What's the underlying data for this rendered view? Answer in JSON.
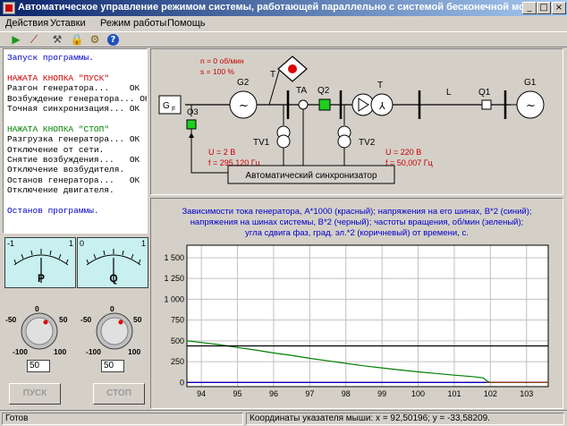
{
  "window": {
    "title": "Автоматическое управление режимом системы, работающей параллельно с системой бесконечной мощности",
    "controls": [
      "_",
      "□",
      "×"
    ]
  },
  "menu": [
    "Действия",
    "Уставки",
    "Режим работы",
    "Помощь"
  ],
  "toolbar": {
    "icons": [
      "play-icon",
      "disconnect-icon",
      "tools-icon",
      "lock-icon",
      "settings-icon",
      "help-icon"
    ]
  },
  "log": {
    "lines": [
      {
        "text": "Запуск программы.",
        "color": "#0000cc"
      },
      {
        "text": "",
        "color": "#000000"
      },
      {
        "text": "НАЖАТА КНОПКА \"ПУСК\"",
        "color": "#cc0000"
      },
      {
        "text": "Разгон генератора...    ОК",
        "color": "#000000"
      },
      {
        "text": "Возбуждение генератора... ОК",
        "color": "#000000"
      },
      {
        "text": "Точная синхронизация... ОК",
        "color": "#000000"
      },
      {
        "text": "",
        "color": "#000000"
      },
      {
        "text": "НАЖАТА КНОПКА \"СТОП\"",
        "color": "#008000"
      },
      {
        "text": "Разгрузка генератора... ОК",
        "color": "#000000"
      },
      {
        "text": "Отключение от сети.",
        "color": "#000000"
      },
      {
        "text": "Снятие возбуждения...   ОК",
        "color": "#000000"
      },
      {
        "text": "Отключение возбудителя.",
        "color": "#000000"
      },
      {
        "text": "Останов генератора...   ОК",
        "color": "#000000"
      },
      {
        "text": "Отключение двигателя.",
        "color": "#000000"
      },
      {
        "text": "",
        "color": "#000000"
      },
      {
        "text": "Останов программы.",
        "color": "#0000cc"
      }
    ]
  },
  "meters": [
    {
      "letter": "P",
      "min": "-1",
      "max": "1",
      "value": 0
    },
    {
      "letter": "Q",
      "min": "0",
      "max": "1",
      "value": 0.5
    }
  ],
  "knobs": [
    {
      "labels": [
        "0",
        "-50",
        "50",
        "-100",
        "100"
      ],
      "input_value": "50"
    },
    {
      "labels": [
        "0",
        "-50",
        "50",
        "-100",
        "100"
      ],
      "input_value": "50"
    }
  ],
  "buttons": {
    "start": "ПУСК",
    "stop": "СТОП"
  },
  "schematic": {
    "speed_text": "n = 0 об/мин",
    "slip_text": "s = 100 %",
    "labels": {
      "G2": "G2",
      "T_top": "T",
      "TA": "TA",
      "Q2": "Q2",
      "T2": "T",
      "L": "L",
      "Q1": "Q1",
      "G1": "G1",
      "GF": "G",
      "GF_sub": "F",
      "Q3": "Q3",
      "TV1": "TV1",
      "TV2": "TV2"
    },
    "gen_voltage": "U = 2 В",
    "gen_freq": "f = 295,120 Гц",
    "sys_voltage": "U = 220 В",
    "sys_freq": "f = 50,007 Гц",
    "synchronizer": "Автоматический синхронизатор"
  },
  "chart_title_lines": [
    "Зависимости тока генератора, А*1000 (красный); напряжения на его шинах, В*2 (синий);",
    "напряжения на шинах системы, В*2 (черный); частоты вращения, об/мин (зеленый);",
    "угла сдвига фаз, град. эл.*2 (коричневый) от времени, с."
  ],
  "chart_data": {
    "type": "line",
    "xlim": [
      93.6,
      103.6
    ],
    "ylim": [
      -50,
      1650
    ],
    "x_ticks": [
      "94",
      "95",
      "96",
      "97",
      "98",
      "99",
      "100",
      "101",
      "102",
      "103"
    ],
    "y_ticks": [
      "0",
      "250",
      "500",
      "750",
      "1 000",
      "1 250",
      "1 500"
    ],
    "grid": true,
    "series": [
      {
        "color": "#008000",
        "x": [
          93.6,
          94,
          94.5,
          95,
          95.5,
          96,
          96.5,
          97,
          97.5,
          98,
          98.5,
          99,
          99.5,
          100,
          100.5,
          101,
          101.5,
          101.8,
          101.9,
          102,
          103.6
        ],
        "y": [
          500,
          480,
          455,
          420,
          390,
          355,
          325,
          290,
          260,
          230,
          200,
          175,
          150,
          128,
          108,
          88,
          70,
          55,
          20,
          0,
          0
        ]
      },
      {
        "color": "#000000",
        "x": [
          93.6,
          103.6
        ],
        "y": [
          440,
          440
        ]
      },
      {
        "color": "#cc0000",
        "x": [
          93.6,
          103.6
        ],
        "y": [
          2,
          2
        ]
      },
      {
        "color": "#0000cc",
        "x": [
          93.6,
          103.6
        ],
        "y": [
          0,
          0
        ]
      },
      {
        "color": "#8b4513",
        "x": [
          101.9,
          103.6
        ],
        "y": [
          0,
          0
        ]
      }
    ]
  },
  "status": {
    "ready": "Готов",
    "coords": "Координаты указателя мыши: x = 92,50196;  y = -33,58209."
  }
}
